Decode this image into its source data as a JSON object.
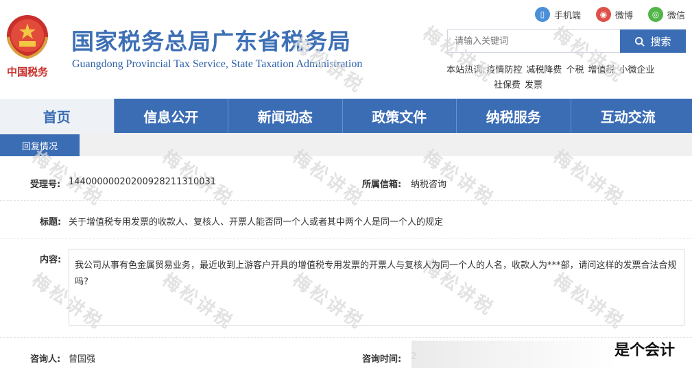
{
  "header": {
    "title": "国家税务总局广东省税务局",
    "subtitle": "Guangdong Provincial Tax Service, State Taxation Administration",
    "emblem_text": "中国税务"
  },
  "top_links": [
    {
      "label": "手机端",
      "icon": "phone-icon",
      "color": "#4a8fd8"
    },
    {
      "label": "微博",
      "icon": "weibo-icon",
      "color": "#e0504a"
    },
    {
      "label": "微信",
      "icon": "wechat-icon",
      "color": "#52b548"
    }
  ],
  "search": {
    "placeholder": "请输入关键词",
    "button_label": "搜索"
  },
  "hot": {
    "label": "本站热词:",
    "terms": [
      "疫情防控",
      "减税降费",
      "个税",
      "增值税",
      "小微企业",
      "社保费",
      "发票"
    ]
  },
  "nav": [
    "首页",
    "信息公开",
    "新闻动态",
    "政策文件",
    "纳税服务",
    "互动交流"
  ],
  "tab": {
    "label": "回复情况"
  },
  "record": {
    "id_label": "受理号:",
    "id_value": "1440000002020092821131003​1",
    "mailbox_label": "所属信箱:",
    "mailbox_value": "纳税咨询",
    "title_label": "标题:",
    "title_value": "关于增值税专用发票的收款人、复核人、开票人能否同一个人或者其中两个人是同一个人的规定",
    "content_label": "内容:",
    "content_value": "我公司从事有色金属贸易业务，最近收到上游客户开具的增值税专用发票的开票人与复核人为同一个人的人名，收款人为***部，请问这样的发票合法合规吗?",
    "asker_label": "咨询人:",
    "asker_value": "曾国强",
    "time_label": "咨询时间:",
    "time_value": "2"
  },
  "watermark": "梅松讲税",
  "corner_text": "是个会计",
  "colors": {
    "brand": "#3b6db5",
    "title": "#3d6fb6"
  }
}
